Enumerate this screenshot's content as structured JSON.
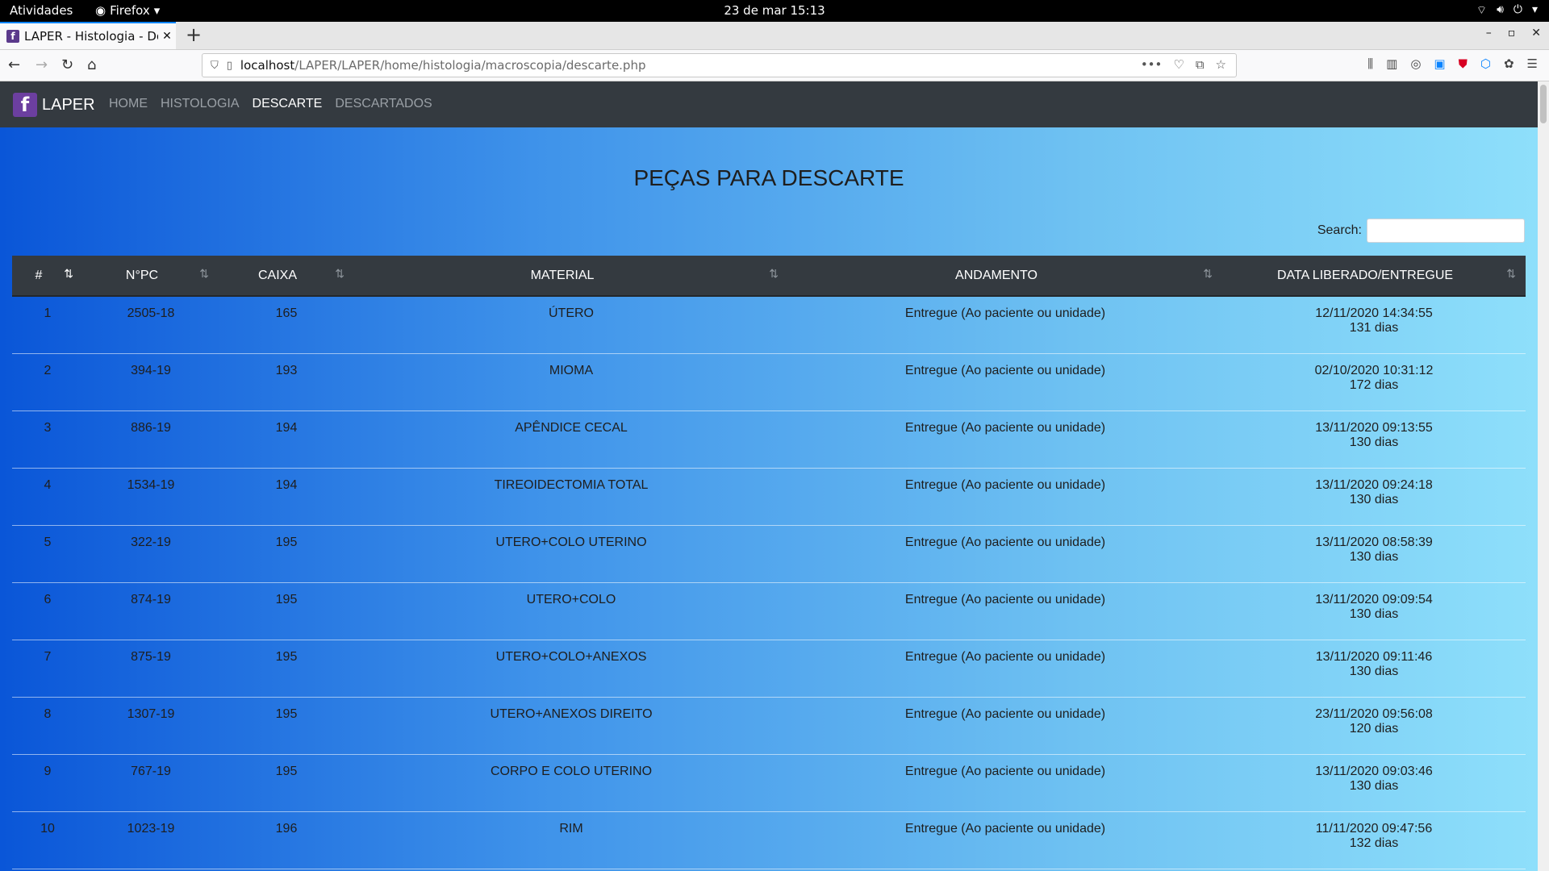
{
  "os_bar": {
    "activities": "Atividades",
    "app": "Firefox",
    "clock": "23 de mar  15:13"
  },
  "browser": {
    "tab_title": "LAPER - Histologia - Des",
    "url_host": "localhost",
    "url_path": "/LAPER/LAPER/home/histologia/macroscopia/descarte.php"
  },
  "app": {
    "brand": "LAPER",
    "logo_letter": "f",
    "nav": [
      "HOME",
      "HISTOLOGIA",
      "DESCARTE",
      "DESCARTADOS"
    ],
    "active_nav": "DESCARTE"
  },
  "page": {
    "title": "PEÇAS PARA DESCARTE",
    "search_label": "Search:",
    "search_value": ""
  },
  "table": {
    "headers": [
      "#",
      "N°PC",
      "CAIXA",
      "MATERIAL",
      "ANDAMENTO",
      "DATA LIBERADO/ENTREGUE"
    ],
    "rows": [
      {
        "n": "1",
        "pc": "2505-18",
        "caixa": "165",
        "material": "ÚTERO",
        "andamento": "Entregue (Ao paciente ou unidade)",
        "data": "12/11/2020 14:34:55",
        "dias": "131 dias"
      },
      {
        "n": "2",
        "pc": "394-19",
        "caixa": "193",
        "material": "MIOMA",
        "andamento": "Entregue (Ao paciente ou unidade)",
        "data": "02/10/2020 10:31:12",
        "dias": "172 dias"
      },
      {
        "n": "3",
        "pc": "886-19",
        "caixa": "194",
        "material": "APÊNDICE CECAL",
        "andamento": "Entregue (Ao paciente ou unidade)",
        "data": "13/11/2020 09:13:55",
        "dias": "130 dias"
      },
      {
        "n": "4",
        "pc": "1534-19",
        "caixa": "194",
        "material": "TIREOIDECTOMIA TOTAL",
        "andamento": "Entregue (Ao paciente ou unidade)",
        "data": "13/11/2020 09:24:18",
        "dias": "130 dias"
      },
      {
        "n": "5",
        "pc": "322-19",
        "caixa": "195",
        "material": "UTERO+COLO UTERINO",
        "andamento": "Entregue (Ao paciente ou unidade)",
        "data": "13/11/2020 08:58:39",
        "dias": "130 dias"
      },
      {
        "n": "6",
        "pc": "874-19",
        "caixa": "195",
        "material": "UTERO+COLO",
        "andamento": "Entregue (Ao paciente ou unidade)",
        "data": "13/11/2020 09:09:54",
        "dias": "130 dias"
      },
      {
        "n": "7",
        "pc": "875-19",
        "caixa": "195",
        "material": "UTERO+COLO+ANEXOS",
        "andamento": "Entregue (Ao paciente ou unidade)",
        "data": "13/11/2020 09:11:46",
        "dias": "130 dias"
      },
      {
        "n": "8",
        "pc": "1307-19",
        "caixa": "195",
        "material": "UTERO+ANEXOS DIREITO",
        "andamento": "Entregue (Ao paciente ou unidade)",
        "data": "23/11/2020 09:56:08",
        "dias": "120 dias"
      },
      {
        "n": "9",
        "pc": "767-19",
        "caixa": "195",
        "material": "CORPO E COLO UTERINO",
        "andamento": "Entregue (Ao paciente ou unidade)",
        "data": "13/11/2020 09:03:46",
        "dias": "130 dias"
      },
      {
        "n": "10",
        "pc": "1023-19",
        "caixa": "196",
        "material": "RIM",
        "andamento": "Entregue (Ao paciente ou unidade)",
        "data": "11/11/2020 09:47:56",
        "dias": "132 dias"
      }
    ]
  }
}
